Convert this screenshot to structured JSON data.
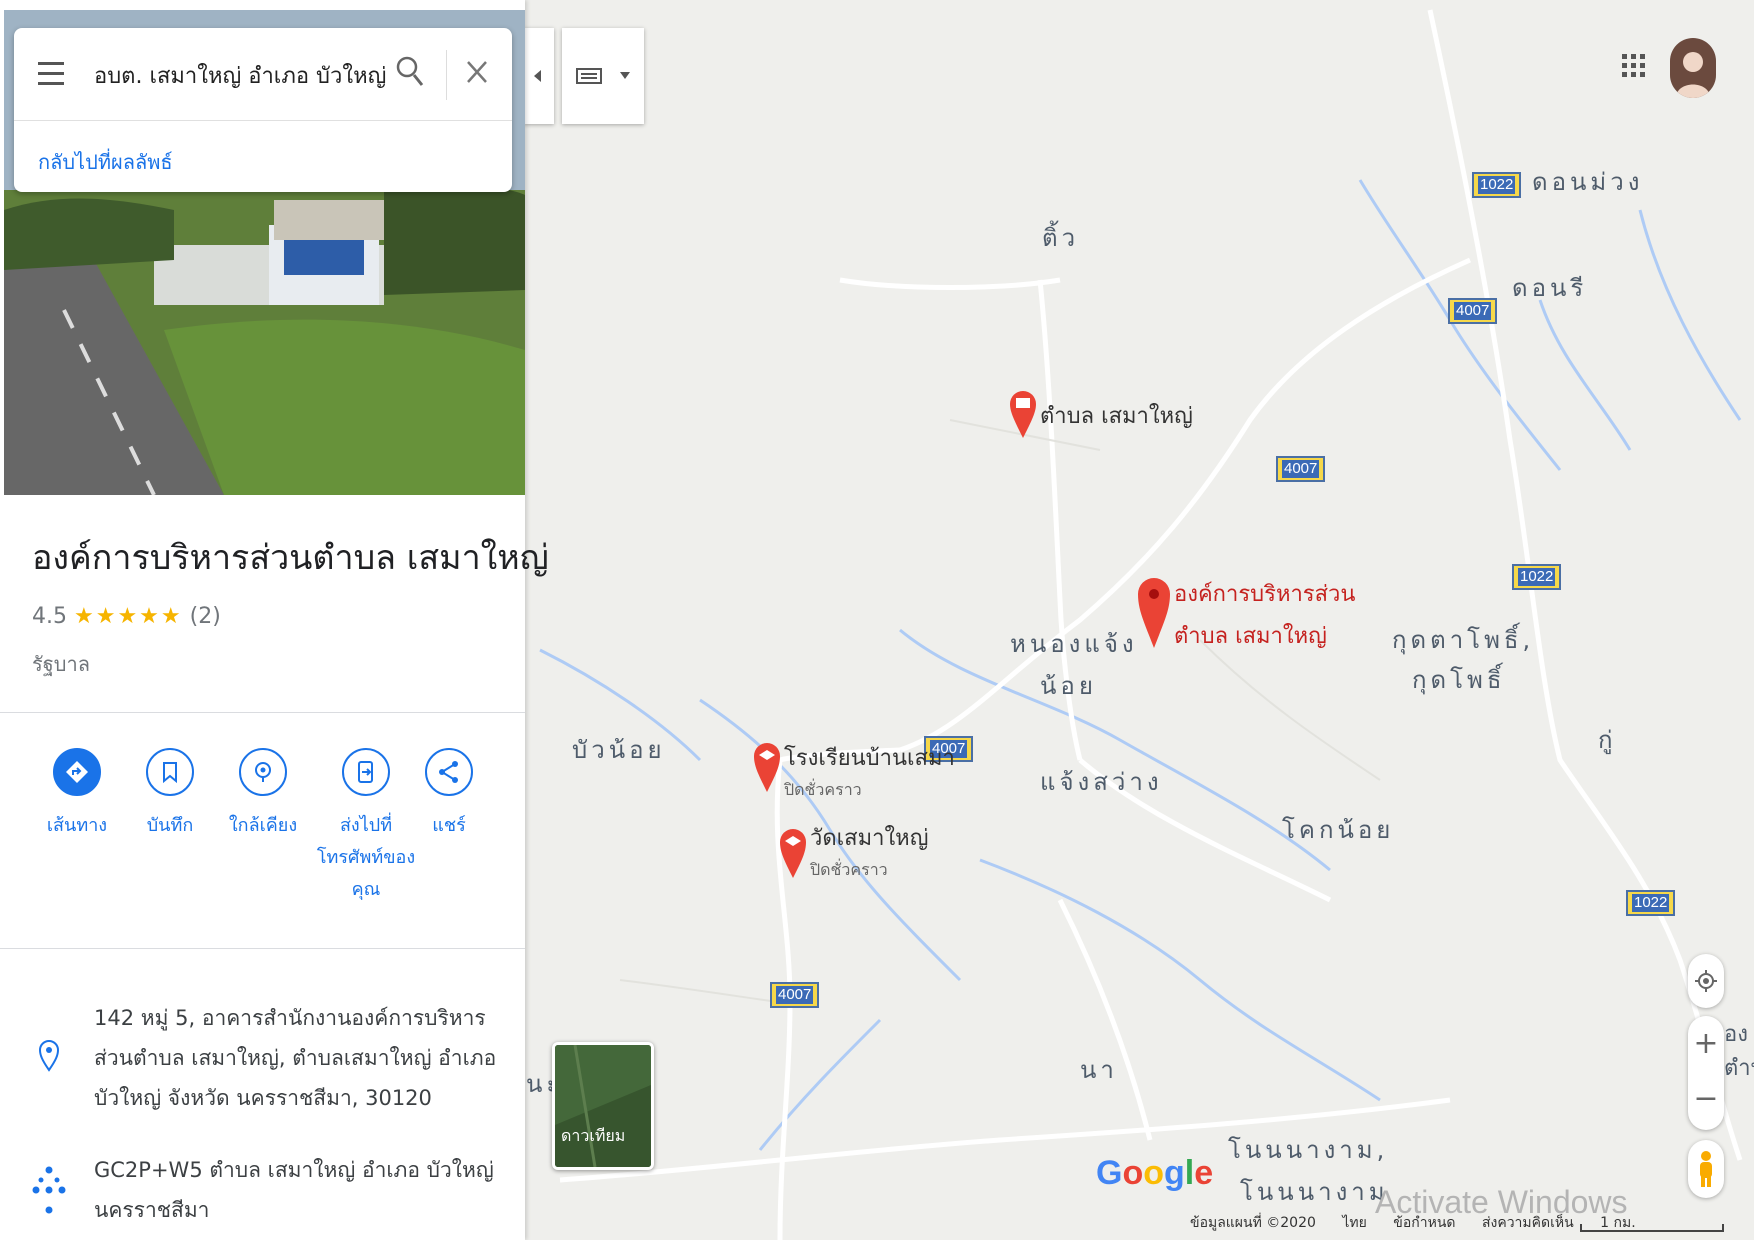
{
  "search": {
    "query": "อบต. เสมาใหญ่ อำเภอ บัวใหญ่ นครราชสีมา",
    "back_link": "กลับไปที่ผลลัพธ์"
  },
  "place": {
    "title": "องค์การบริหารส่วนตำบล เสมาใหญ่",
    "rating": "4.5",
    "stars": "★★★★★",
    "review_count": "(2)",
    "category": "รัฐบาล"
  },
  "actions": [
    {
      "label": "เส้นทาง",
      "icon": "directions-icon"
    },
    {
      "label": "บันทึก",
      "icon": "bookmark-icon"
    },
    {
      "label": "ใกล้เคียง",
      "icon": "nearby-icon"
    },
    {
      "label": "ส่งไปที่\nโทรศัพท์ของ\nคุณ",
      "icon": "send-to-phone-icon"
    },
    {
      "label": "แชร์",
      "icon": "share-icon"
    }
  ],
  "info": {
    "address": "142 หมู่ 5, อาคารสำนักงานองค์การบริหารส่วนตำบล เสมาใหญ่, ตำบลเสมาใหญ่ อำเภอบัวใหญ่ จังหวัด นครราชสีมา, 30120",
    "plus_code": "GC2P+W5 ตำบล เสมาใหญ่ อำเภอ บัวใหญ่ นครราชสีมา"
  },
  "map": {
    "place_labels": [
      "ดอนม่วง",
      "ดอนรี",
      "ติ้ว",
      "หนองแจ้ง",
      "น้อย",
      "กุดตาโพธิ์,",
      "กุดโพธิ์",
      "บัวน้อย",
      "แจ้งสว่าง",
      "โคกน้อย",
      "กู่",
      "นา",
      "โนนนางาม,",
      "โนนนางาม",
      "นะ"
    ],
    "route_shields": [
      "1022",
      "4007",
      "4007",
      "1022",
      "4007",
      "1022",
      "4007"
    ],
    "pois": {
      "tambon": "ตำบล เสมาใหญ่",
      "selected_line1": "องค์การบริหารส่วน",
      "selected_line2": "ตำบล เสมาใหญ่",
      "school": "โรงเรียนบ้านเสมา",
      "school_status": "ปิดชั่วคราว",
      "temple": "วัดเสมาใหญ่",
      "temple_status": "ปิดชั่วคราว"
    },
    "right_edge_text": [
      "อง",
      "ตำบ"
    ],
    "satellite_label": "ดาวเทียม",
    "google_logo": "Google",
    "watermark": "Activate Windows",
    "footer": [
      "ข้อมูลแผนที่ ©2020",
      "ไทย",
      "ข้อกำหนด",
      "ส่งความคิดเห็น",
      "1 กม."
    ]
  },
  "colors": {
    "accent": "#1a73e8",
    "pin_red": "#ea4335",
    "road_label": "#4e5b6a"
  }
}
